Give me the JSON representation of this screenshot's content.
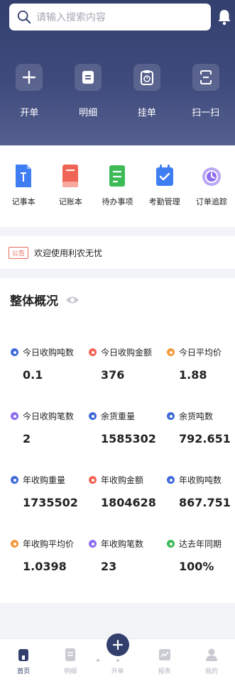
{
  "search": {
    "placeholder": "请输入搜索内容"
  },
  "quick_actions": [
    {
      "label": "开单",
      "icon": "plus-icon"
    },
    {
      "label": "明细",
      "icon": "document-icon"
    },
    {
      "label": "挂单",
      "icon": "clipboard-timer-icon"
    },
    {
      "label": "扫一扫",
      "icon": "scan-icon"
    }
  ],
  "tools": [
    {
      "label": "记事本",
      "icon": "notebook-icon",
      "color": "#3f7df3"
    },
    {
      "label": "记账本",
      "icon": "ledger-icon",
      "color": "#ef6454"
    },
    {
      "label": "待办事项",
      "icon": "todo-icon",
      "color": "#3cba55"
    },
    {
      "label": "考勤管理",
      "icon": "attendance-icon",
      "color": "#3f7df3"
    },
    {
      "label": "订单追踪",
      "icon": "order-track-icon",
      "color": "#8d6cf0"
    }
  ],
  "notice": {
    "tag": "公告",
    "text": "欢迎使用利农无忧"
  },
  "overview": {
    "title": "整体概况",
    "stats": [
      {
        "label": "今日收购吨数",
        "value": "0.1",
        "color": "#3f6ad8"
      },
      {
        "label": "今日收购金额",
        "value": "376",
        "color": "#ef6454"
      },
      {
        "label": "今日平均价",
        "value": "1.88",
        "color": "#f39a3c"
      },
      {
        "label": "今日收购笔数",
        "value": "2",
        "color": "#8d6cf0"
      },
      {
        "label": "余货重量",
        "value": "1585302",
        "color": "#3f6ad8"
      },
      {
        "label": "余货吨数",
        "value": "792.651",
        "color": "#3f6ad8"
      },
      {
        "label": "年收购重量",
        "value": "1735502",
        "color": "#3f6ad8"
      },
      {
        "label": "年收购金额",
        "value": "1804628",
        "color": "#ef6454"
      },
      {
        "label": "年收购吨数",
        "value": "867.751",
        "color": "#3f6ad8"
      },
      {
        "label": "年收购平均价",
        "value": "1.0398",
        "color": "#f39a3c"
      },
      {
        "label": "年收购笔数",
        "value": "23",
        "color": "#8d6cf0"
      },
      {
        "label": "达去年同期",
        "value": "100%",
        "color": "#3cba55"
      }
    ]
  },
  "tabbar": [
    {
      "label": "首页",
      "icon": "home-icon",
      "active": true
    },
    {
      "label": "明细",
      "icon": "detail-icon",
      "active": false
    },
    {
      "label": "开单",
      "icon": "add-order-icon",
      "active": false
    },
    {
      "label": "报表",
      "icon": "report-icon",
      "active": false
    },
    {
      "label": "我的",
      "icon": "user-icon",
      "active": false
    }
  ],
  "colors": {
    "primary": "#33406e",
    "accent_red": "#e36a5c"
  }
}
